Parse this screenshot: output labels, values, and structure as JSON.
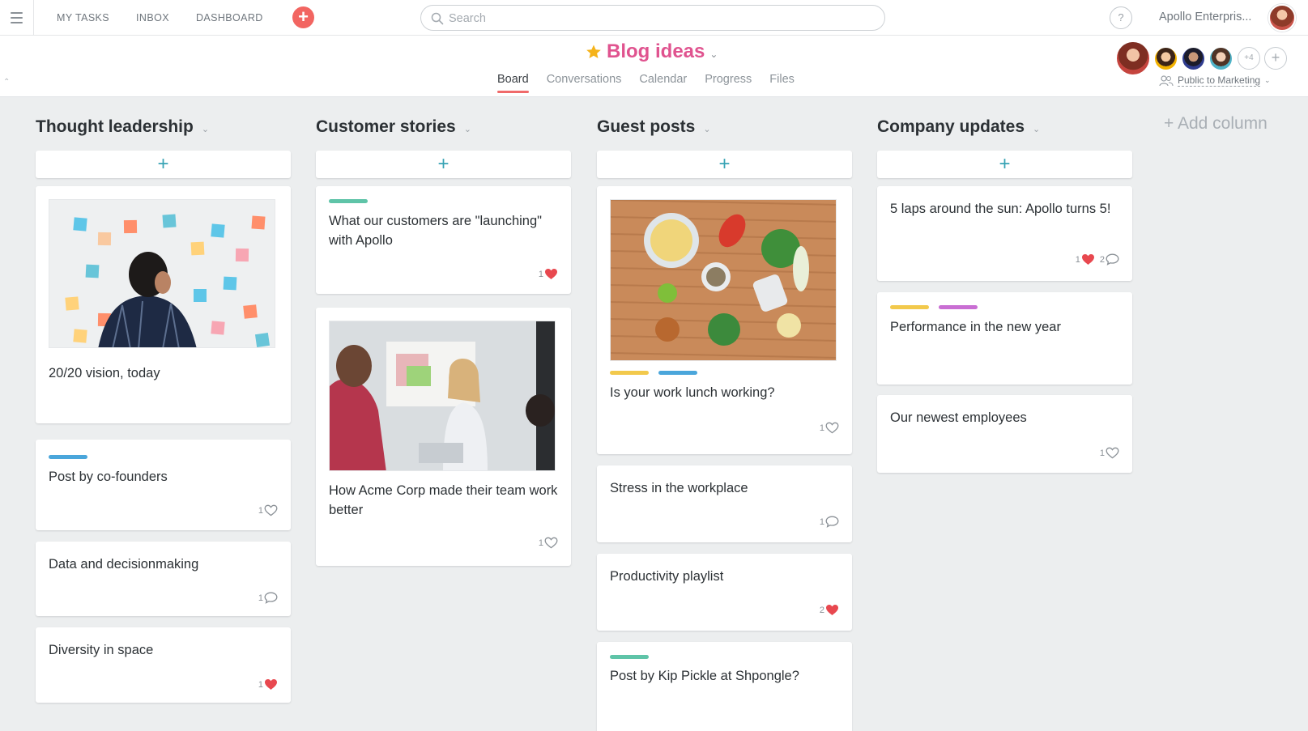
{
  "topbar": {
    "nav": [
      "MY TASKS",
      "INBOX",
      "DASHBOARD"
    ],
    "search_placeholder": "Search",
    "help": "?",
    "org_name": "Apollo Enterpris..."
  },
  "project": {
    "title": "Blog ideas",
    "tabs": [
      "Board",
      "Conversations",
      "Calendar",
      "Progress",
      "Files"
    ],
    "active_tab": "Board",
    "members_more": "+4",
    "privacy": "Public to Marketing"
  },
  "colors": {
    "accent_pink": "#e0538f",
    "tab_underline": "#f06a6a",
    "add_plus": "#37a3b4",
    "tag_teal": "#5fc4a8",
    "tag_blue": "#4aa6db",
    "tag_yellow": "#f2c94c",
    "tag_purple": "#c96ed3",
    "heart_red": "#e8484f"
  },
  "columns": [
    {
      "title": "Thought leadership",
      "cards": [
        {
          "title": "20/20 vision, today",
          "image": "sticky-notes-photo"
        },
        {
          "title": "Post by co-founders",
          "tags": [
            "blue"
          ],
          "likes": "1",
          "liked": false
        },
        {
          "title": "Data and decisionmaking",
          "comments": "1"
        },
        {
          "title": "Diversity in space",
          "likes": "1",
          "liked": true
        }
      ]
    },
    {
      "title": "Customer stories",
      "cards": [
        {
          "title": "What our customers are \"launching\" with Apollo",
          "tags": [
            "teal"
          ],
          "likes": "1",
          "liked": true
        },
        {
          "title": "How Acme Corp made their team work better",
          "image": "meeting-photo",
          "likes": "1",
          "liked": false
        }
      ]
    },
    {
      "title": "Guest posts",
      "cards": [
        {
          "title": "Is your work lunch working?",
          "image": "food-photo",
          "tags": [
            "yellow",
            "blue"
          ],
          "likes": "1",
          "liked": false
        },
        {
          "title": "Stress in the workplace",
          "comments": "1"
        },
        {
          "title": "Productivity playlist",
          "likes": "2",
          "liked": true
        },
        {
          "title": "Post by Kip Pickle at Shpongle?",
          "tags": [
            "teal"
          ]
        }
      ]
    },
    {
      "title": "Company updates",
      "cards": [
        {
          "title": "5 laps around the sun: Apollo turns 5!",
          "likes": "1",
          "liked": true,
          "comments": "2"
        },
        {
          "title": "Performance in the new year",
          "tags": [
            "yellow",
            "purple"
          ]
        },
        {
          "title": "Our newest employees",
          "likes": "1",
          "liked": false
        }
      ]
    }
  ],
  "add_column_label": "+ Add column",
  "add_task_symbol": "+"
}
